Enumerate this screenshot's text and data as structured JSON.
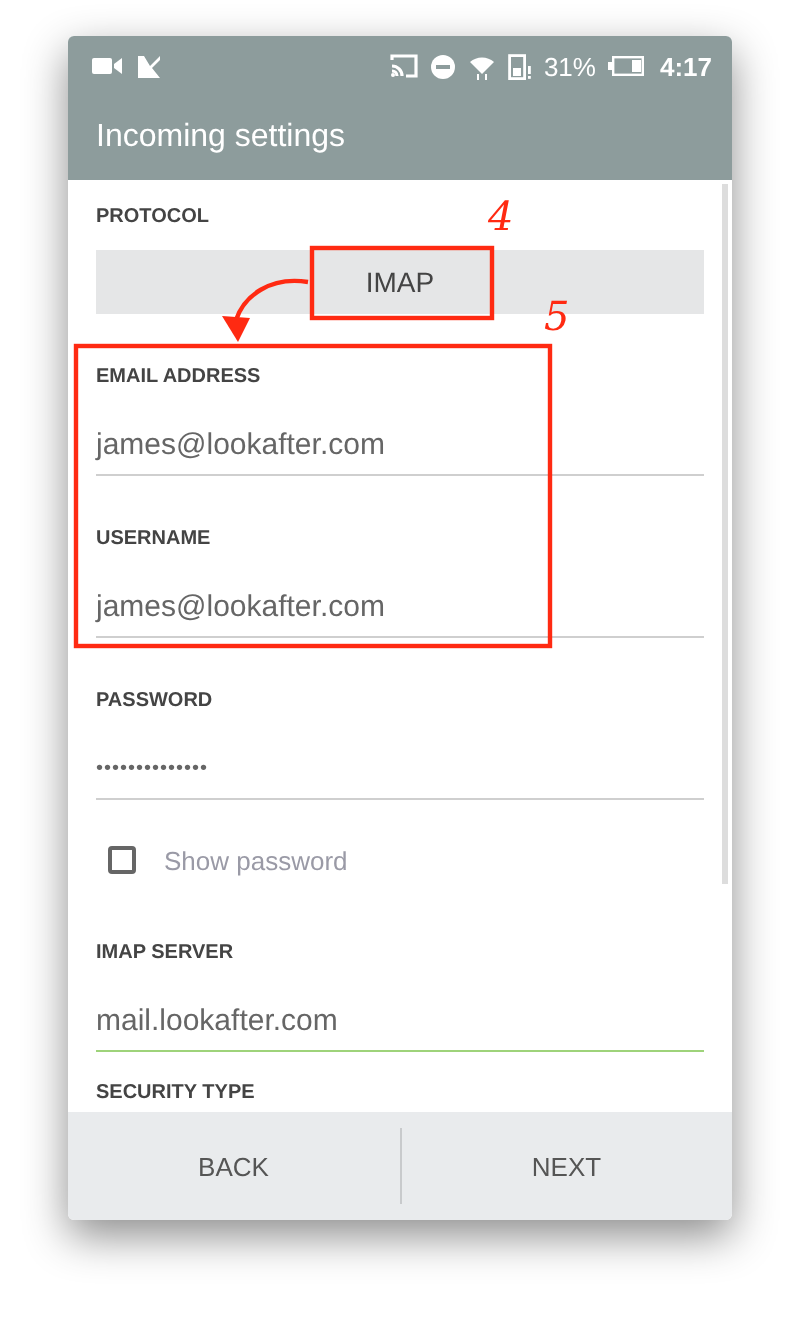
{
  "status_bar": {
    "battery": "31%",
    "time": "4:17"
  },
  "app_bar": {
    "title": "Incoming settings"
  },
  "protocol": {
    "label": "PROTOCOL",
    "value": "IMAP"
  },
  "form": [
    {
      "kind": "text",
      "label": "EMAIL ADDRESS",
      "value": "james@lookafter.com",
      "focused": false
    },
    {
      "kind": "text",
      "label": "USERNAME",
      "value": "james@lookafter.com",
      "focused": false
    },
    {
      "kind": "password",
      "label": "PASSWORD",
      "value": "••••••••••••••",
      "focused": false
    },
    {
      "kind": "checkbox",
      "label": "Show password",
      "checked": false
    },
    {
      "kind": "text",
      "label": "IMAP SERVER",
      "value": "mail.lookafter.com",
      "focused": true
    },
    {
      "kind": "heading",
      "label": "SECURITY TYPE"
    }
  ],
  "buttons": [
    {
      "label": "BACK"
    },
    {
      "label": "NEXT"
    }
  ],
  "annotations": [
    {
      "text": "4"
    },
    {
      "text": "5"
    }
  ]
}
